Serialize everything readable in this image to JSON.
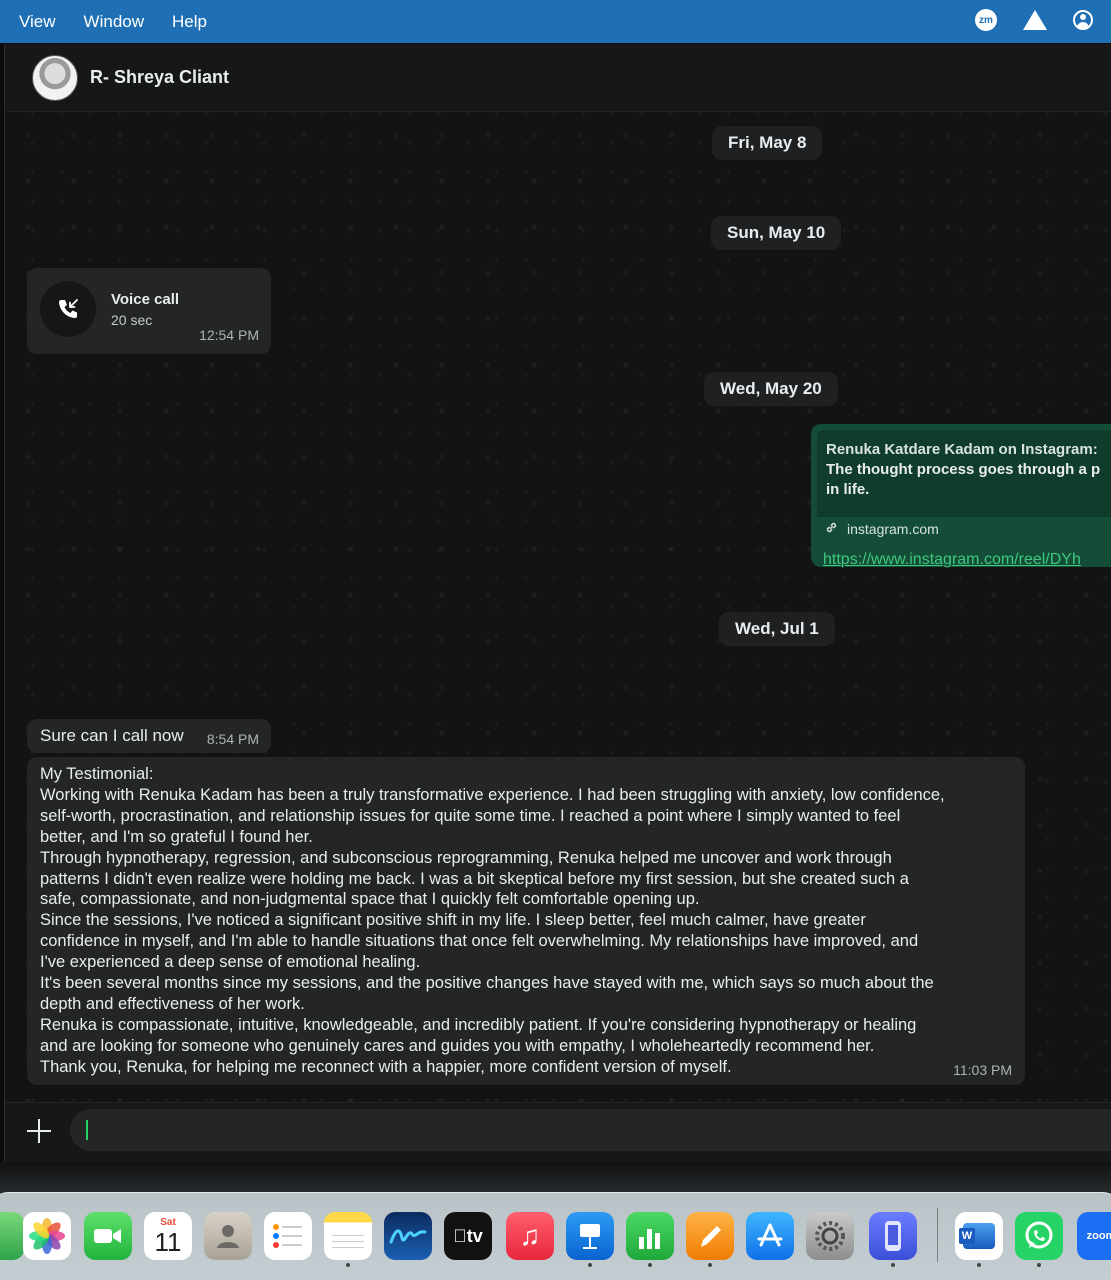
{
  "menubar": {
    "items": [
      "View",
      "Window",
      "Help"
    ],
    "tray": {
      "zoom_badge": "zm"
    }
  },
  "chat": {
    "contact_name": "R- Shreya Cliant",
    "dates": [
      "Fri, May 8",
      "Sun, May 10",
      "Wed, May 20",
      "Wed, Jul 1"
    ],
    "voice_call": {
      "title": "Voice call",
      "duration": "20 sec",
      "time": "12:54 PM"
    },
    "link_message": {
      "title": "Renuka Katdare Kadam on Instagram:",
      "desc_line1": "The thought process goes through a p",
      "desc_line2": "in life.",
      "domain": "instagram.com",
      "url": "https://www.instagram.com/reel/DYh"
    },
    "short_message": {
      "text": "Sure can I call now",
      "time": "8:54 PM"
    },
    "long_message": {
      "lines": [
        "My Testimonial:",
        "Working with Renuka Kadam has been a truly transformative experience. I had been struggling with anxiety, low confidence,",
        "self-worth, procrastination, and relationship issues for quite some time. I reached a point where I simply wanted to feel",
        "better, and I'm so grateful I found her.",
        "Through hypnotherapy, regression, and subconscious reprogramming, Renuka helped me uncover and work through",
        "patterns I didn't even realize were holding me back. I was a bit skeptical before my first session, but she created such a",
        "safe, compassionate, and non-judgmental space that I quickly felt comfortable opening up.",
        "Since the sessions, I've noticed a significant positive shift in my life. I sleep better, feel much calmer, have greater",
        "confidence in myself, and I'm able to handle situations that once felt overwhelming. My relationships have improved, and",
        "I've experienced a deep sense of emotional healing.",
        "It's been several months since my sessions, and the positive changes have stayed with me, which says so much about the",
        "depth and effectiveness of her work.",
        "Renuka is compassionate, intuitive, knowledgeable, and incredibly patient. If you're considering hypnotherapy or healing",
        "and are looking for someone who genuinely cares and guides you with empathy, I wholeheartedly recommend her.",
        "Thank you, Renuka, for helping me reconnect with a happier, more confident version of myself."
      ],
      "time": "11:03 PM"
    }
  },
  "dock": {
    "calendar": {
      "month": "Sat",
      "day": "11"
    },
    "tv_label": "tv",
    "word_label": "W",
    "zoom_label": "zoom"
  },
  "colors": {
    "menubar": "#1f6fb5",
    "incoming_bubble": "#242626",
    "outgoing_bubble": "#144d37",
    "link": "#3ec77d"
  }
}
